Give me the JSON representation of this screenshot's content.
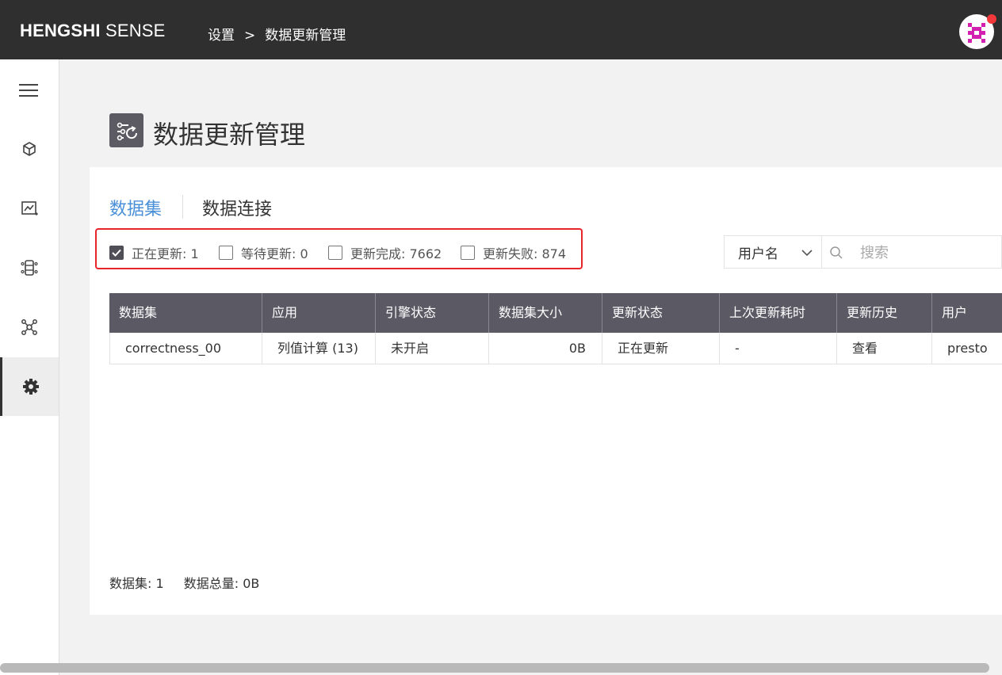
{
  "brand": {
    "bold": "HENGSHI",
    "thin": "SENSE"
  },
  "breadcrumb": {
    "parent": "设置",
    "separator": ">",
    "current": "数据更新管理"
  },
  "page": {
    "title": "数据更新管理"
  },
  "tabs": [
    {
      "label": "数据集",
      "active": true
    },
    {
      "label": "数据连接",
      "active": false
    }
  ],
  "filters": [
    {
      "label": "正在更新: 1",
      "checked": true
    },
    {
      "label": "等待更新: 0",
      "checked": false
    },
    {
      "label": "更新完成: 7662",
      "checked": false
    },
    {
      "label": "更新失败: 874",
      "checked": false
    }
  ],
  "search": {
    "field_select": "用户名",
    "placeholder": "搜索"
  },
  "table": {
    "headers": [
      "数据集",
      "应用",
      "引擎状态",
      "数据集大小",
      "更新状态",
      "上次更新耗时",
      "更新历史",
      "用户"
    ],
    "rows": [
      [
        "correctness_00",
        "列值计算 (13)",
        "未开启",
        "0B",
        "正在更新",
        "-",
        "查看",
        "presto"
      ]
    ]
  },
  "footer": {
    "dataset_count": "数据集: 1",
    "total_size": "数据总量: 0B"
  },
  "colors": {
    "accent": "#4a90d9",
    "header_bg": "#5b5a64",
    "topbar": "#2f2f2f",
    "highlight_box": "#e8262a",
    "notification": "#f2383a"
  },
  "sidebar_icons": [
    "menu-icon",
    "cube-icon",
    "chart-icon",
    "dataset-icon",
    "network-icon",
    "gear-icon"
  ]
}
